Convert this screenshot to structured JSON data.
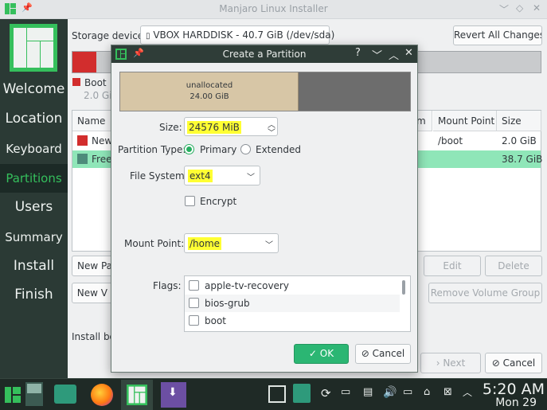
{
  "window": {
    "title": "Manjaro Linux Installer"
  },
  "sidebar": {
    "items": [
      {
        "label": "Welcome"
      },
      {
        "label": "Location"
      },
      {
        "label": "Keyboard"
      },
      {
        "label": "Partitions"
      },
      {
        "label": "Users"
      },
      {
        "label": "Summary"
      },
      {
        "label": "Install"
      },
      {
        "label": "Finish"
      }
    ],
    "active": "Partitions"
  },
  "main": {
    "storage_label": "Storage device:",
    "storage_device": "VBOX HARDDISK - 40.7 GiB (/dev/sda)",
    "revert_button": "Revert All Changes",
    "legend_boot": "Boot",
    "legend_boot_size": "2.0 GiB",
    "table": {
      "headers": [
        "Name",
        "m",
        "Mount Point",
        "Size"
      ],
      "rows": [
        {
          "name": "New",
          "mount": "/boot",
          "size": "2.0 GiB"
        },
        {
          "name": "Free",
          "mount": "",
          "size": "38.7 GiB"
        }
      ]
    },
    "new_partition_table_button": "New Par",
    "new_volume_button": "New V",
    "edit_button": "Edit",
    "delete_button": "Delete",
    "remove_volume_group_button": "Remove Volume Group",
    "install_boot_label": "Install bo",
    "next_button": "Next",
    "cancel_button": "Cancel"
  },
  "dialog": {
    "title": "Create a Partition",
    "bar_label_1": "unallocated",
    "bar_label_2": "24.00 GiB",
    "bar_fraction": 0.615,
    "size_label": "Size:",
    "size_value": "24576 MiB",
    "partition_type_label": "Partition Type:",
    "type_primary": "Primary",
    "type_extended": "Extended",
    "type_selected": "Primary",
    "file_system_label": "File System:",
    "file_system_value": "ext4",
    "encrypt_label": "Encrypt",
    "mount_point_label": "Mount Point:",
    "mount_point_value": "/home",
    "flags_label": "Flags:",
    "flags": [
      "apple-tv-recovery",
      "bios-grub",
      "boot"
    ],
    "ok_button": "OK",
    "cancel_button": "Cancel"
  },
  "taskbar": {
    "time": "5:20 AM",
    "date": "Mon 29"
  },
  "colors": {
    "accent": "#35bf5c",
    "sidebar": "#2b3a35",
    "highlight": "#ffff33",
    "ok_button": "#2bb673",
    "boot_partition": "#d22d2d",
    "selected_row": "#8fe6b8"
  }
}
